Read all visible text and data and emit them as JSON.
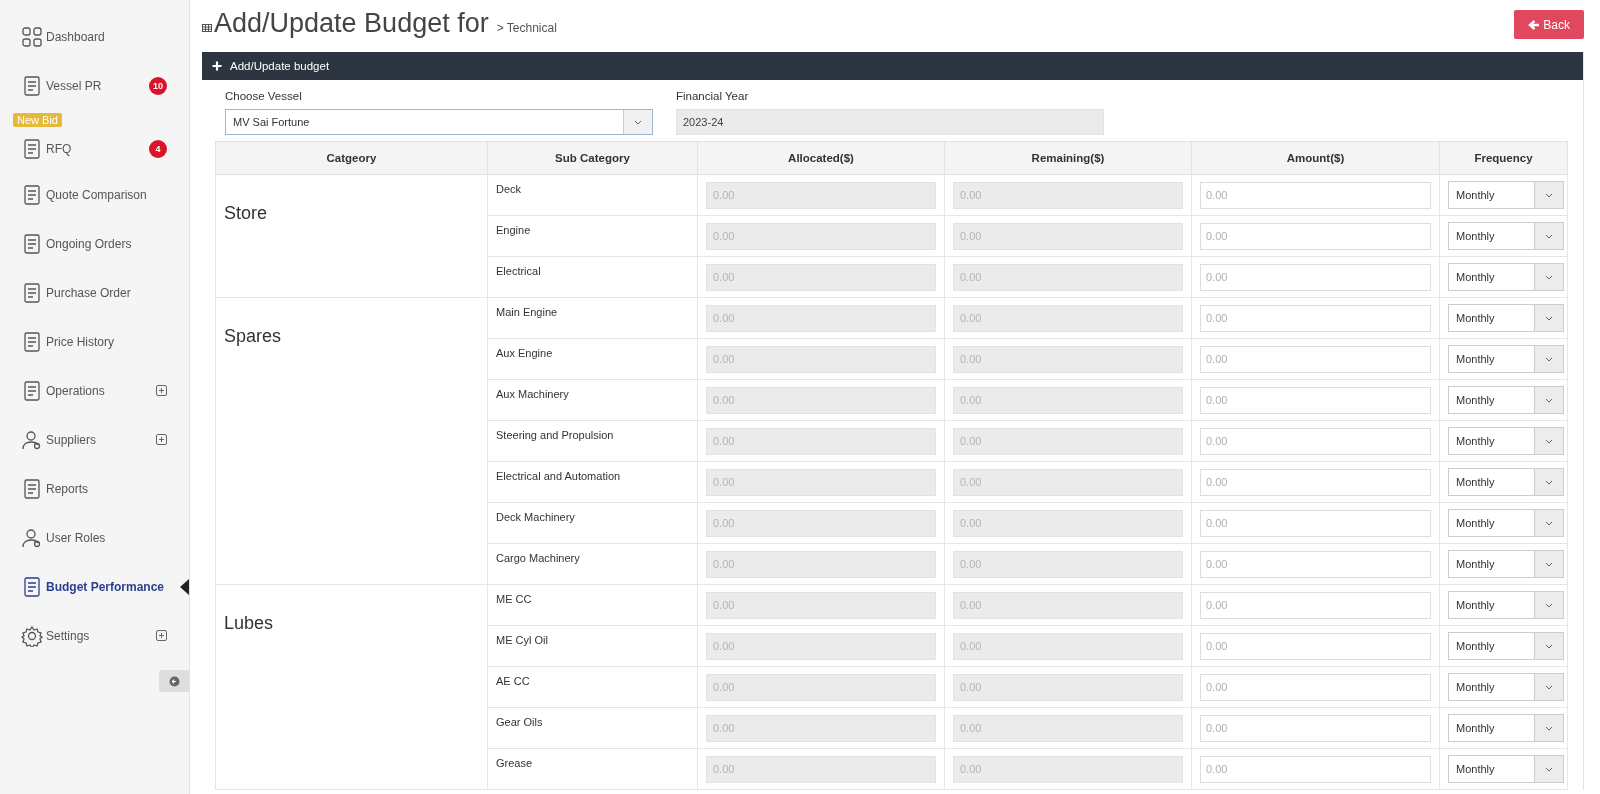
{
  "sidebar": {
    "items": [
      {
        "label": "Dashboard",
        "selected": false,
        "expandable": false
      },
      {
        "label": "Vessel PR",
        "selected": false,
        "expandable": false,
        "badge": "10"
      },
      {
        "label": "RFQ",
        "selected": false,
        "expandable": false,
        "badge": "4",
        "tag": "New Bid"
      },
      {
        "label": "Quote Comparison",
        "selected": false,
        "expandable": false
      },
      {
        "label": "Ongoing Orders",
        "selected": false,
        "expandable": false
      },
      {
        "label": "Purchase Order",
        "selected": false,
        "expandable": false
      },
      {
        "label": "Price History",
        "selected": false,
        "expandable": false
      },
      {
        "label": "Operations",
        "selected": false,
        "expandable": true
      },
      {
        "label": "Suppliers",
        "selected": false,
        "expandable": true
      },
      {
        "label": "Reports",
        "selected": false,
        "expandable": false
      },
      {
        "label": "User Roles",
        "selected": false,
        "expandable": false
      },
      {
        "label": "Budget Performance",
        "selected": true,
        "expandable": false
      },
      {
        "label": "Settings",
        "selected": false,
        "expandable": true
      }
    ]
  },
  "header": {
    "title": "Add/Update Budget for",
    "breadcrumb": "> Technical",
    "back_button": "Back"
  },
  "panel": {
    "title": "Add/Update budget",
    "vessel": {
      "label": "Choose Vessel",
      "value": "MV Sai Fortune"
    },
    "financial_year": {
      "label": "Financial Year",
      "value": "2023-24"
    }
  },
  "table": {
    "columns": [
      "Catgeory",
      "Sub Category",
      "Allocated($)",
      "Remaining($)",
      "Amount($)",
      "Frequency"
    ],
    "groups": [
      {
        "category": "Store",
        "rows": [
          {
            "sub_category": "Deck",
            "allocated": "0.00",
            "remaining": "0.00",
            "amount_placeholder": "0.00",
            "frequency": "Monthly"
          },
          {
            "sub_category": "Engine",
            "allocated": "0.00",
            "remaining": "0.00",
            "amount_placeholder": "0.00",
            "frequency": "Monthly"
          },
          {
            "sub_category": "Electrical",
            "allocated": "0.00",
            "remaining": "0.00",
            "amount_placeholder": "0.00",
            "frequency": "Monthly"
          }
        ]
      },
      {
        "category": "Spares",
        "rows": [
          {
            "sub_category": "Main Engine",
            "allocated": "0.00",
            "remaining": "0.00",
            "amount_placeholder": "0.00",
            "frequency": "Monthly"
          },
          {
            "sub_category": "Aux Engine",
            "allocated": "0.00",
            "remaining": "0.00",
            "amount_placeholder": "0.00",
            "frequency": "Monthly"
          },
          {
            "sub_category": "Aux Machinery",
            "allocated": "0.00",
            "remaining": "0.00",
            "amount_placeholder": "0.00",
            "frequency": "Monthly"
          },
          {
            "sub_category": "Steering and Propulsion",
            "allocated": "0.00",
            "remaining": "0.00",
            "amount_placeholder": "0.00",
            "frequency": "Monthly"
          },
          {
            "sub_category": "Electrical and Automation",
            "allocated": "0.00",
            "remaining": "0.00",
            "amount_placeholder": "0.00",
            "frequency": "Monthly"
          },
          {
            "sub_category": "Deck Machinery",
            "allocated": "0.00",
            "remaining": "0.00",
            "amount_placeholder": "0.00",
            "frequency": "Monthly"
          },
          {
            "sub_category": "Cargo Machinery",
            "allocated": "0.00",
            "remaining": "0.00",
            "amount_placeholder": "0.00",
            "frequency": "Monthly"
          }
        ]
      },
      {
        "category": "Lubes",
        "rows": [
          {
            "sub_category": "ME CC",
            "allocated": "0.00",
            "remaining": "0.00",
            "amount_placeholder": "0.00",
            "frequency": "Monthly"
          },
          {
            "sub_category": "ME Cyl Oil",
            "allocated": "0.00",
            "remaining": "0.00",
            "amount_placeholder": "0.00",
            "frequency": "Monthly"
          },
          {
            "sub_category": "AE CC",
            "allocated": "0.00",
            "remaining": "0.00",
            "amount_placeholder": "0.00",
            "frequency": "Monthly"
          },
          {
            "sub_category": "Gear Oils",
            "allocated": "0.00",
            "remaining": "0.00",
            "amount_placeholder": "0.00",
            "frequency": "Monthly"
          },
          {
            "sub_category": "Grease",
            "allocated": "0.00",
            "remaining": "0.00",
            "amount_placeholder": "0.00",
            "frequency": "Monthly"
          }
        ]
      }
    ]
  }
}
